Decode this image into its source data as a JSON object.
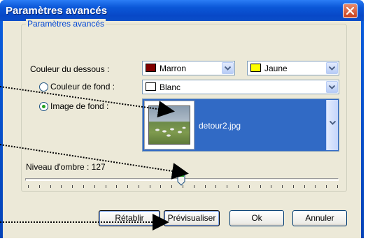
{
  "window": {
    "title": "Paramètres avancés"
  },
  "group": {
    "legend": "Paramètres avancés"
  },
  "dessous": {
    "label": "Couleur du dessous :",
    "color1": {
      "value": "Marron",
      "swatch": "#800000"
    },
    "color2": {
      "value": "Jaune",
      "swatch": "#ffff00"
    }
  },
  "fond": {
    "color_label": "Couleur de fond :",
    "color_value": "Blanc",
    "color_swatch": "#ffffff",
    "image_label": "Image de fond :",
    "image_value": "detour2.jpg",
    "selected": "image"
  },
  "ombre": {
    "label": "Niveau d'ombre : 127",
    "value": 127,
    "max": 255
  },
  "buttons": {
    "reset": "Rétablir",
    "preview": "Prévisualiser",
    "ok": "Ok",
    "cancel": "Annuler"
  },
  "icons": [
    "close-icon",
    "chevron-down-icon",
    "slider-thumb-icon",
    "annotation-arrow-icon"
  ]
}
